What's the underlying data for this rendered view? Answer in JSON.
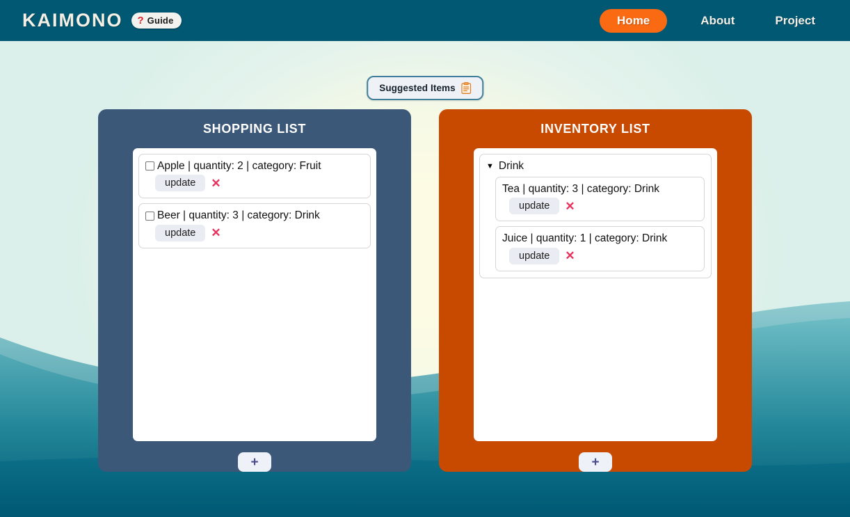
{
  "header": {
    "brand": "KAIMONO",
    "guide": {
      "mark": "?",
      "label": "Guide"
    },
    "nav": [
      {
        "label": "Home",
        "active": true
      },
      {
        "label": "About",
        "active": false
      },
      {
        "label": "Project",
        "active": false
      }
    ]
  },
  "suggested": {
    "label": "Suggested Items",
    "icon": "clipboard-icon"
  },
  "shopping": {
    "title": "SHOPPING LIST",
    "add_label": "+",
    "items": [
      {
        "text": "Apple | quantity: 2 | category: Fruit",
        "checked": false,
        "update_label": "update",
        "delete_label": "✕"
      },
      {
        "text": "Beer | quantity: 3 | category: Drink",
        "checked": false,
        "update_label": "update",
        "delete_label": "✕"
      }
    ]
  },
  "inventory": {
    "title": "INVENTORY LIST",
    "add_label": "+",
    "groups": [
      {
        "name": "Drink",
        "expanded": true,
        "marker": "▼",
        "items": [
          {
            "text": "Tea | quantity: 3 | category: Drink",
            "update_label": "update",
            "delete_label": "✕"
          },
          {
            "text": "Juice | quantity: 1 | category: Drink",
            "update_label": "update",
            "delete_label": "✕"
          }
        ]
      }
    ]
  },
  "colors": {
    "header_bg": "#005873",
    "accent_orange": "#fa6a12",
    "shopping_panel": "#3b5878",
    "inventory_panel": "#c74a00",
    "delete_red": "#e8305a",
    "plus_purple": "#4a4a8f"
  }
}
